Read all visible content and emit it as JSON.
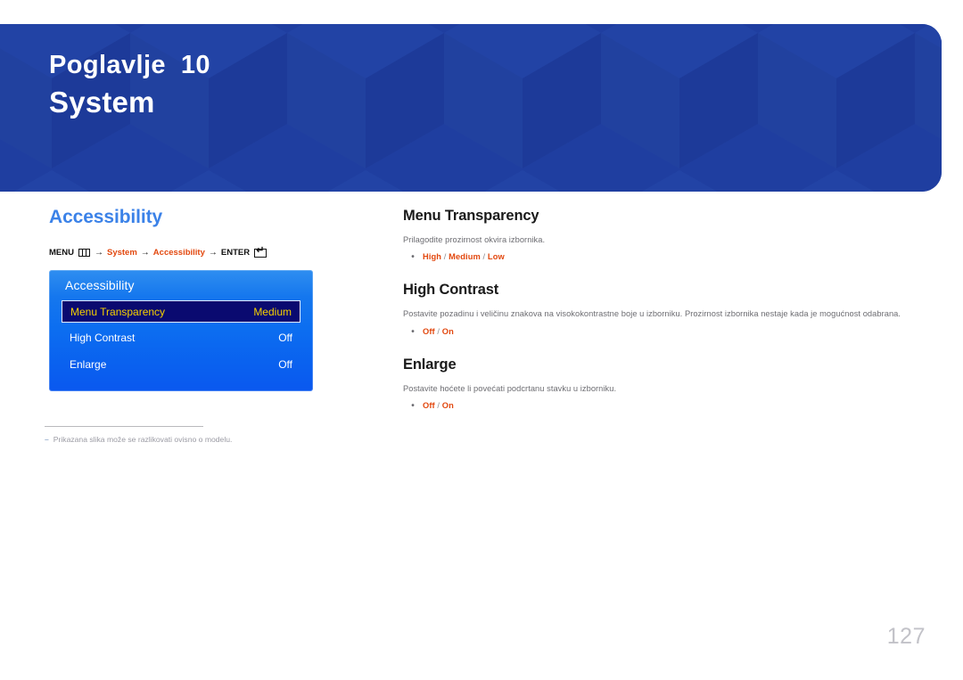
{
  "header": {
    "chapter_label": "Poglavlje  10",
    "chapter_title": "System"
  },
  "left": {
    "section_title": "Accessibility",
    "breadcrumb": {
      "menu_label": "MENU",
      "menu_icon": "menu-grid-icon",
      "arrow": "→",
      "crumb1": "System",
      "crumb2": "Accessibility",
      "enter_label": "ENTER",
      "enter_icon": "enter-return-icon"
    },
    "osd": {
      "title": "Accessibility",
      "rows": [
        {
          "label": "Menu Transparency",
          "value": "Medium",
          "selected": true
        },
        {
          "label": "High Contrast",
          "value": "Off",
          "selected": false
        },
        {
          "label": "Enlarge",
          "value": "Off",
          "selected": false
        }
      ]
    },
    "footnote": {
      "dash": "–",
      "text": "Prikazana slika može se razlikovati ovisno o modelu."
    }
  },
  "right": {
    "items": [
      {
        "title": "Menu Transparency",
        "desc": "Prilagodite prozirnost okvira izbornika.",
        "bullet": "•",
        "options": [
          "High",
          "Medium",
          "Low"
        ]
      },
      {
        "title": "High Contrast",
        "desc": "Postavite pozadinu i veličinu znakova na visokokontrastne boje u izborniku. Prozirnost izbornika nestaje kada je mogućnost odabrana.",
        "bullet": "•",
        "options": [
          "Off",
          "On"
        ]
      },
      {
        "title": "Enlarge",
        "desc": "Postavite hoćete li povećati podcrtanu stavku u izborniku.",
        "bullet": "•",
        "options": [
          "Off",
          "On"
        ]
      }
    ]
  },
  "page_number": "127",
  "colors": {
    "banner_blue": "#1f3fa0",
    "accent_blue": "#3b82e8",
    "accent_orange": "#e2480f",
    "osd_selected_bg": "#0a0a70",
    "osd_selected_text": "#f5d000",
    "page_number_gray": "#c2c2c8"
  }
}
